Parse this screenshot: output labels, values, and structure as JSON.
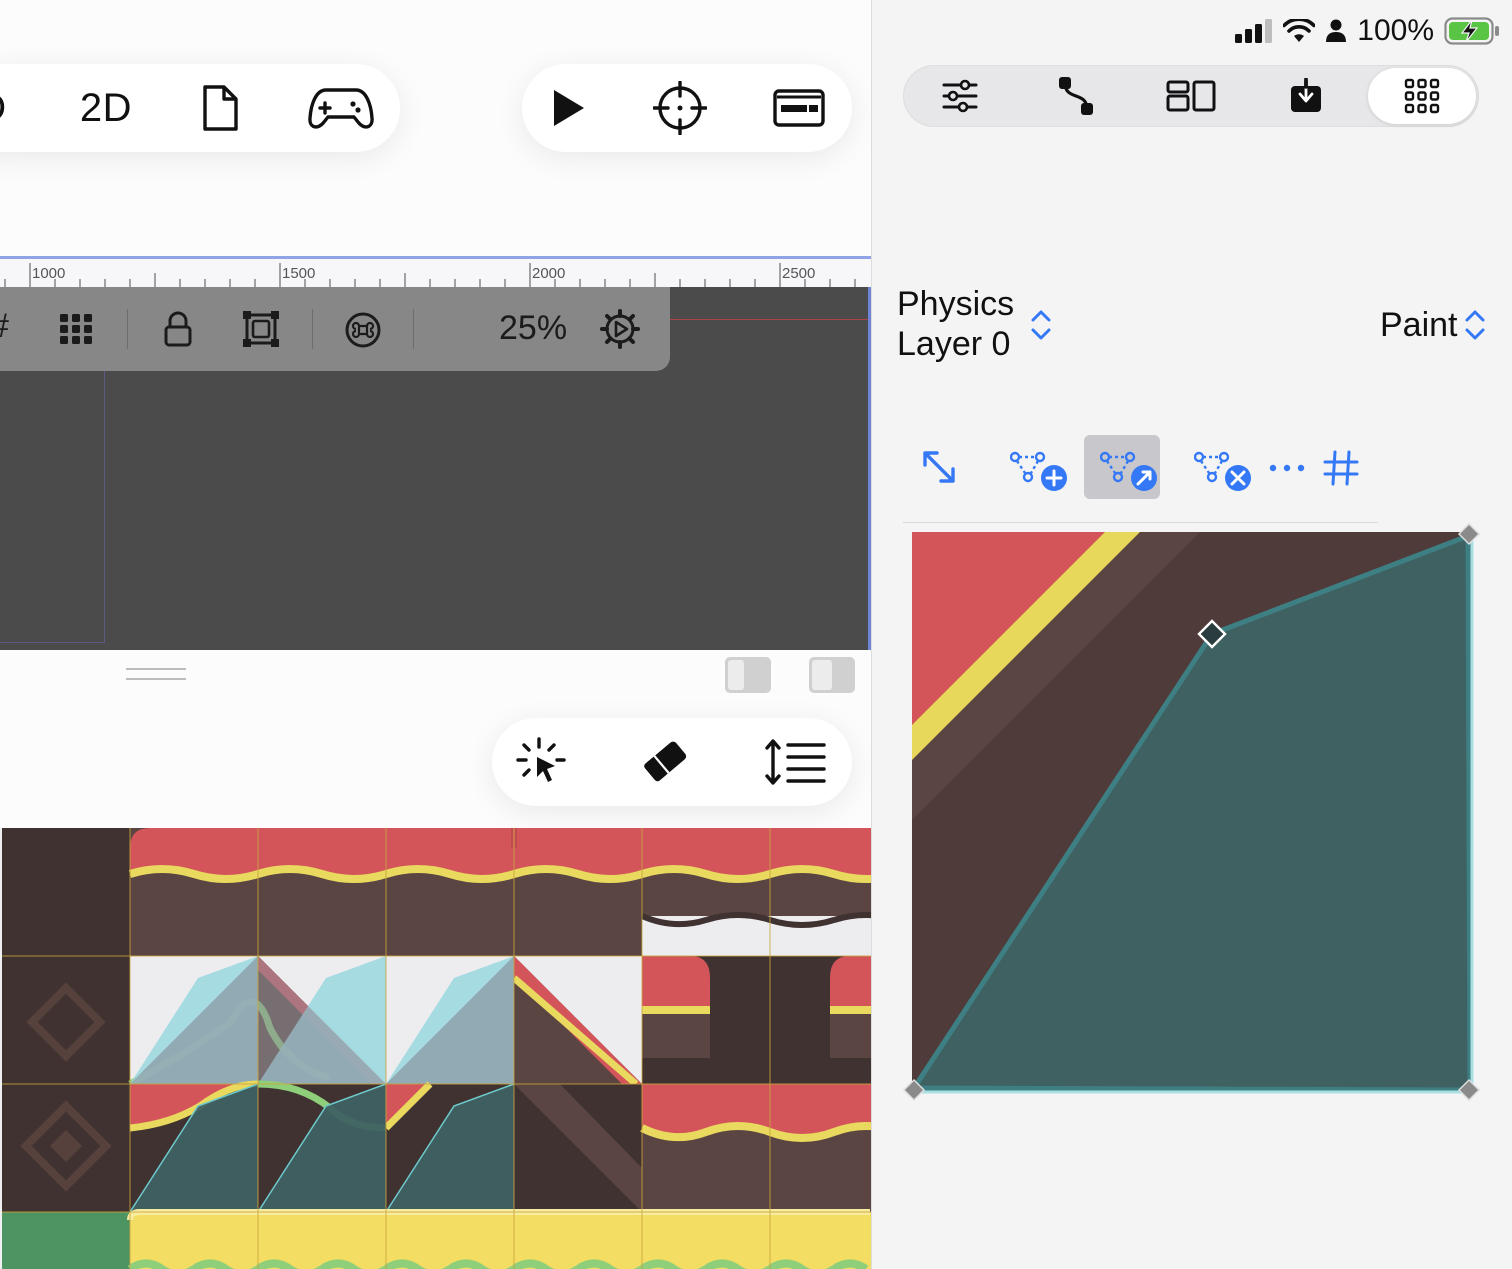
{
  "toolbar": {
    "partial_glyph": "D",
    "mode_2d": "2D",
    "icons": [
      "document-icon",
      "gamepad-icon",
      "play-icon",
      "crosshair-icon",
      "console-icon"
    ]
  },
  "ruler": {
    "labels": [
      "1000",
      "1500",
      "2000",
      "2500"
    ]
  },
  "viewport_toolbar": {
    "partial_glyph": "#",
    "zoom": "25%",
    "icons": [
      "grid-icon",
      "lock-icon",
      "frame-icon",
      "command-icon",
      "gear-icon"
    ]
  },
  "bottom_tools": {
    "icons": [
      "magic-select-icon",
      "eraser-icon",
      "line-spacing-icon"
    ]
  },
  "status_bar": {
    "battery": "100%",
    "icons": [
      "signal-icon",
      "wifi-icon",
      "person-icon",
      "battery-icon"
    ]
  },
  "inspector": {
    "tabs": [
      "sliders-icon",
      "path-icon",
      "layout-icon",
      "download-icon",
      "grid-icon"
    ],
    "selected_tab": 4,
    "layer_picker": {
      "line1": "Physics",
      "line2": "Layer 0"
    },
    "mode_picker": "Paint",
    "polygon_tools": [
      "resize-icon",
      "add-point-icon",
      "move-point-icon",
      "remove-point-icon",
      "more-icon",
      "hash-icon"
    ],
    "selected_tool": 2
  },
  "colors": {
    "accent": "#3478f6",
    "tile_red": "#d3555a",
    "tile_yellow": "#e9d95e",
    "tile_brown": "#5b4542",
    "tile_dark": "#3f3231",
    "polygon_fill": "#3f6162",
    "polygon_stroke": "#6ec9cc",
    "viewport_bg": "#4b4b4b"
  }
}
